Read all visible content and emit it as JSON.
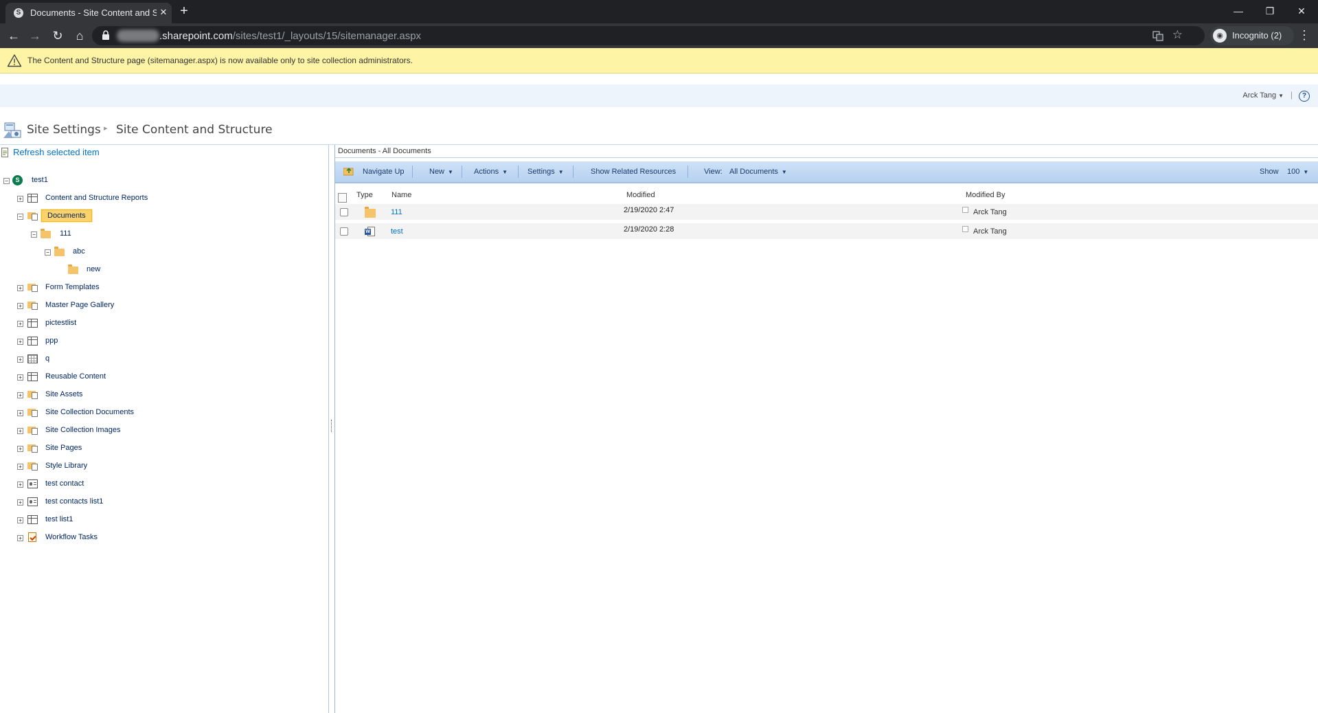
{
  "browser": {
    "tab_title": "Documents - Site Content and Structure",
    "url_host": ".sharepoint.com",
    "url_path": "/sites/test1/_layouts/15/sitemanager.aspx",
    "profile_label": "Incognito (2)",
    "new_tab_glyph": "+",
    "close_glyph": "✕",
    "minimize_glyph": "—",
    "restore_glyph": "❐",
    "window_close_glyph": "✕"
  },
  "banner": {
    "message": "The Content and Structure page (sitemanager.aspx) is now available only to site collection administrators.",
    "color": "#fdf4a6"
  },
  "suite_bar": {
    "user_name": "Arck Tang",
    "separator": "|"
  },
  "title_area": {
    "breadcrumb_root": "Site Settings",
    "breadcrumb_current": "Site Content and Structure",
    "separator_glyph": "▸"
  },
  "tree": {
    "refresh_label": "Refresh selected item",
    "root_label": "test1",
    "items": [
      {
        "label": "Content and Structure Reports",
        "icon": "list-icon",
        "toggle": "+"
      },
      {
        "label": "Documents",
        "icon": "document-library-icon",
        "toggle": "−",
        "selected": true
      },
      {
        "label": "111",
        "icon": "folder-icon",
        "toggle": "−"
      },
      {
        "label": "abc",
        "icon": "folder-icon",
        "toggle": "−"
      },
      {
        "label": "new",
        "icon": "folder-icon",
        "toggle": ""
      },
      {
        "label": "Form Templates",
        "icon": "document-library-icon",
        "toggle": "+"
      },
      {
        "label": "Master Page Gallery",
        "icon": "document-library-icon",
        "toggle": "+"
      },
      {
        "label": "pictestlist",
        "icon": "list-icon",
        "toggle": "+"
      },
      {
        "label": "ppp",
        "icon": "list-icon",
        "toggle": "+"
      },
      {
        "label": "q",
        "icon": "grid-icon",
        "toggle": "+"
      },
      {
        "label": "Reusable Content",
        "icon": "list-icon",
        "toggle": "+"
      },
      {
        "label": "Site Assets",
        "icon": "document-library-icon",
        "toggle": "+"
      },
      {
        "label": "Site Collection Documents",
        "icon": "document-library-icon",
        "toggle": "+"
      },
      {
        "label": "Site Collection Images",
        "icon": "document-library-icon",
        "toggle": "+"
      },
      {
        "label": "Site Pages",
        "icon": "document-library-icon",
        "toggle": "+"
      },
      {
        "label": "Style Library",
        "icon": "document-library-icon",
        "toggle": "+"
      },
      {
        "label": "test contact",
        "icon": "contacts-icon",
        "toggle": "+"
      },
      {
        "label": "test contacts list1",
        "icon": "contacts-icon",
        "toggle": "+"
      },
      {
        "label": "test list1",
        "icon": "list-icon",
        "toggle": "+"
      },
      {
        "label": "Workflow Tasks",
        "icon": "task-icon",
        "toggle": "+"
      }
    ]
  },
  "content": {
    "caption": "Documents - All Documents",
    "ribbon": {
      "navigate_up": "Navigate Up",
      "new": "New",
      "actions": "Actions",
      "settings": "Settings",
      "show_related": "Show Related Resources",
      "view_label": "View:",
      "view_value": "All Documents",
      "show_label": "Show",
      "show_value": "100",
      "caret": "▼"
    },
    "columns": {
      "type": "Type",
      "name": "Name",
      "modified": "Modified",
      "modified_by": "Modified By"
    },
    "rows": [
      {
        "type": "folder-icon",
        "name": "111",
        "modified": "2/19/2020 2:47",
        "modified_by": "Arck Tang"
      },
      {
        "type": "word-document-icon",
        "name": "test",
        "modified": "2/19/2020 2:28",
        "modified_by": "Arck Tang"
      }
    ]
  }
}
